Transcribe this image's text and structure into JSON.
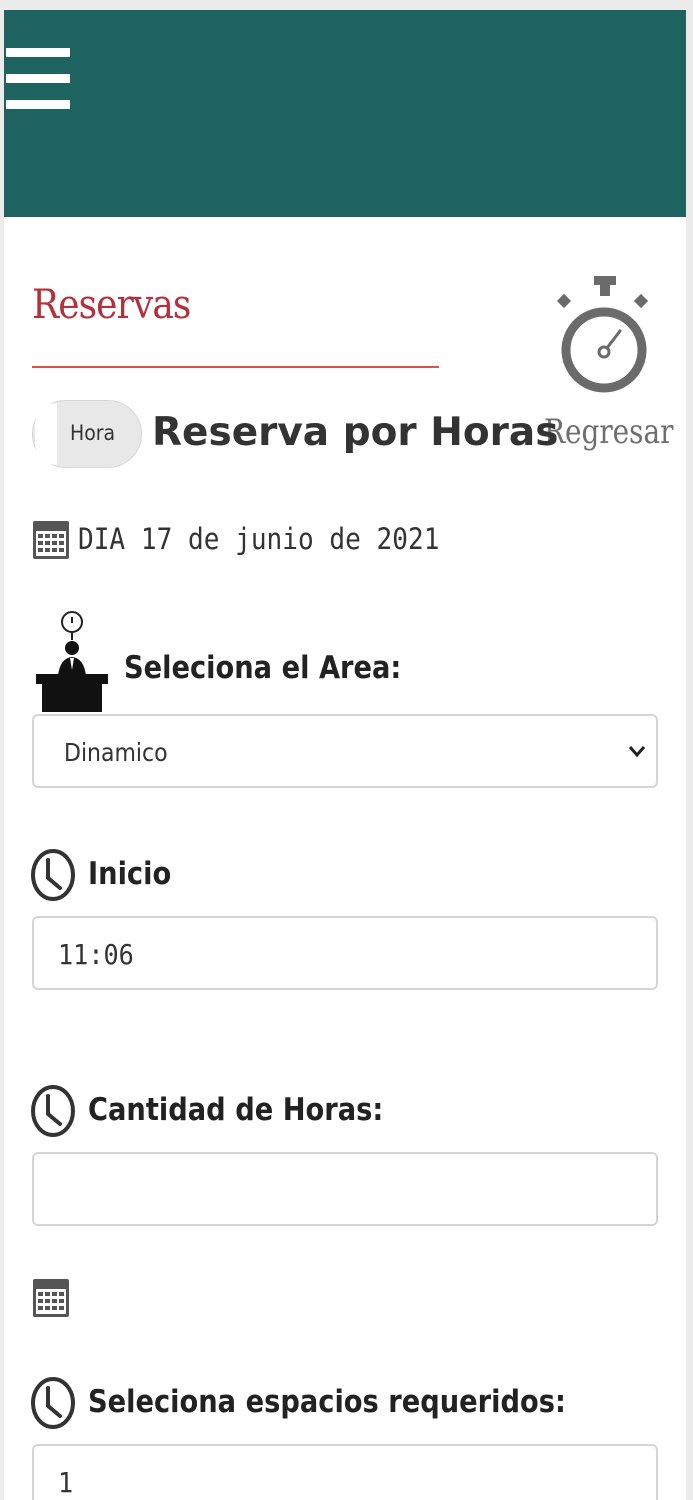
{
  "header": {
    "menu_icon": "hamburger-menu-icon",
    "background_color": "#1e6360"
  },
  "page": {
    "title": "Reservas",
    "title_color": "#b5303a",
    "back_label": "Regresar",
    "back_icon": "stopwatch-icon"
  },
  "mode": {
    "toggle_label": "Hora",
    "title": "Reserva por Horas"
  },
  "date": {
    "icon": "calendar-icon",
    "text": "DIA 17 de junio de 2021"
  },
  "area": {
    "icon": "desk-person-icon",
    "label": "Seleciona el Area:",
    "selected": "Dinamico"
  },
  "inicio": {
    "icon": "clock-icon",
    "label": "Inicio",
    "value": "11:06"
  },
  "cantidad": {
    "icon": "clock-icon",
    "label": "Cantidad de Horas:",
    "value": ""
  },
  "calendar_extra": {
    "icon": "calendar-icon"
  },
  "espacios": {
    "icon": "clock-icon",
    "label": "Seleciona espacios requeridos:",
    "value": "1"
  }
}
